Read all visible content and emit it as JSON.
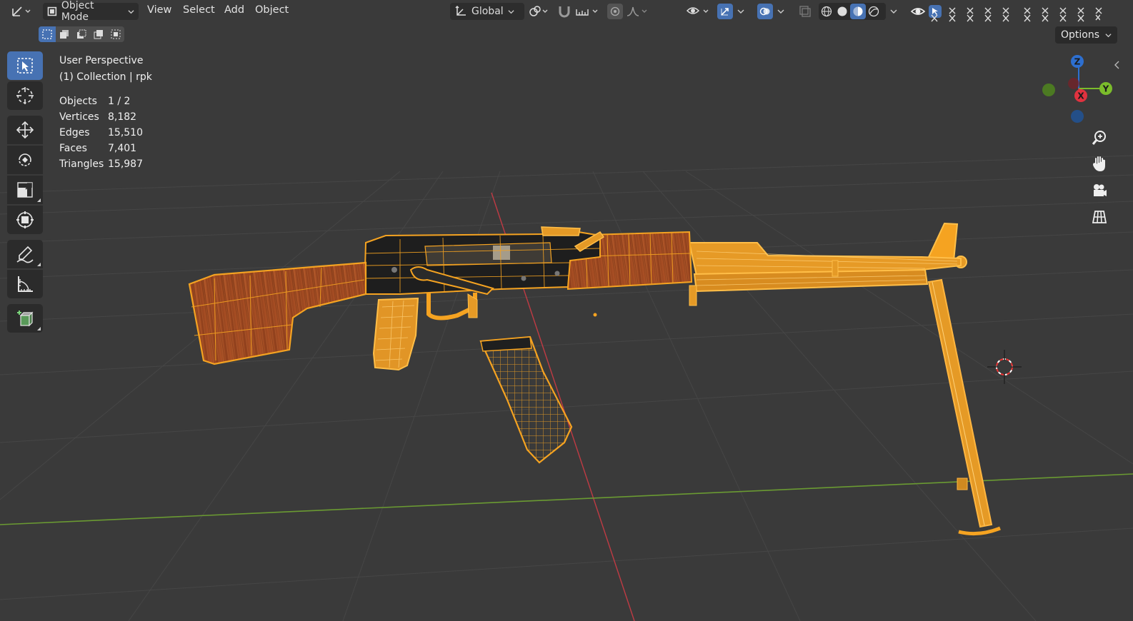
{
  "header": {
    "mode_label": "Object Mode",
    "menus": [
      "View",
      "Select",
      "Add",
      "Object"
    ],
    "orientation_label": "Global",
    "options_label": "Options"
  },
  "overlay": {
    "view_name": "User Perspective",
    "collection": "(1) Collection | rpk",
    "stats": [
      {
        "label": "Objects",
        "value": "1 / 2"
      },
      {
        "label": "Vertices",
        "value": "8,182"
      },
      {
        "label": "Edges",
        "value": "15,510"
      },
      {
        "label": "Faces",
        "value": "7,401"
      },
      {
        "label": "Triangles",
        "value": "15,987"
      }
    ]
  },
  "gizmo": {
    "x": "X",
    "y": "Y",
    "z": "Z"
  },
  "colors": {
    "background": "#3a3a3a",
    "grid": "#444444",
    "x_axis": "#c03a44",
    "y_axis": "#6a9a32",
    "selection_orange": "#f5a321",
    "wood": "#9a4a22",
    "metal": "#222222",
    "accent": "#4772b3"
  },
  "icons": {
    "editor_type": "axes-icon",
    "tools": [
      "select-box-icon",
      "cursor-icon",
      "move-icon",
      "rotate-icon",
      "scale-icon",
      "transform-icon",
      "annotate-icon",
      "measure-icon",
      "add-cube-icon"
    ],
    "nav": [
      "zoom-icon",
      "pan-hand-icon",
      "camera-icon",
      "ortho-grid-icon"
    ]
  }
}
